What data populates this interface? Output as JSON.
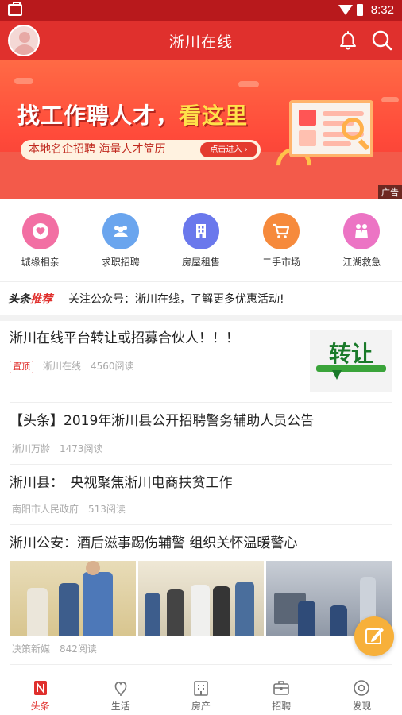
{
  "status_bar": {
    "time": "8:32"
  },
  "header": {
    "title": "淅川在线"
  },
  "banner": {
    "headline_a": "找工作聘人才，",
    "headline_b": "看这里",
    "subline": "本地名企招聘  海量人才简历",
    "button": "点击进入 ›",
    "ad_tag": "广告"
  },
  "categories": [
    {
      "label": "城缘相亲",
      "icon": "heart-icon",
      "color": "#f26fa3"
    },
    {
      "label": "求职招聘",
      "icon": "people-icon",
      "color": "#6aa5ee"
    },
    {
      "label": "房屋租售",
      "icon": "building-icon",
      "color": "#6a78ec"
    },
    {
      "label": "二手市场",
      "icon": "cart-icon",
      "color": "#f68a3c"
    },
    {
      "label": "江湖救急",
      "icon": "hands-icon",
      "color": "#ec74c4"
    }
  ],
  "ticker": {
    "logo_a": "头条",
    "logo_b": "推荐",
    "text": "关注公众号：淅川在线，了解更多优惠活动!"
  },
  "news": [
    {
      "title": "淅川在线平台转让或招募合伙人！！！",
      "badge": "置顶",
      "source": "淅川在线",
      "reads": "4560阅读",
      "thumb_text": "转让"
    },
    {
      "title": "【头条】2019年淅川县公开招聘警务辅助人员公告",
      "source": "淅川万龄",
      "reads": "1473阅读"
    },
    {
      "title": "淅川县：　央视聚焦淅川电商扶贫工作",
      "source": "南阳市人民政府",
      "reads": "513阅读"
    },
    {
      "title": "淅川公安：酒后滋事踢伤辅警 组织关怀温暖警心",
      "source": "决策新媒",
      "reads": "842阅读"
    }
  ],
  "bottom_nav": [
    {
      "label": "头条",
      "icon": "headline-icon",
      "active": true
    },
    {
      "label": "生活",
      "icon": "life-icon",
      "active": false
    },
    {
      "label": "房产",
      "icon": "building-icon",
      "active": false
    },
    {
      "label": "招聘",
      "icon": "briefcase-icon",
      "active": false
    },
    {
      "label": "发现",
      "icon": "discover-icon",
      "active": false
    }
  ],
  "colors": {
    "brand": "#e0302d",
    "fab": "#f7b03a"
  }
}
